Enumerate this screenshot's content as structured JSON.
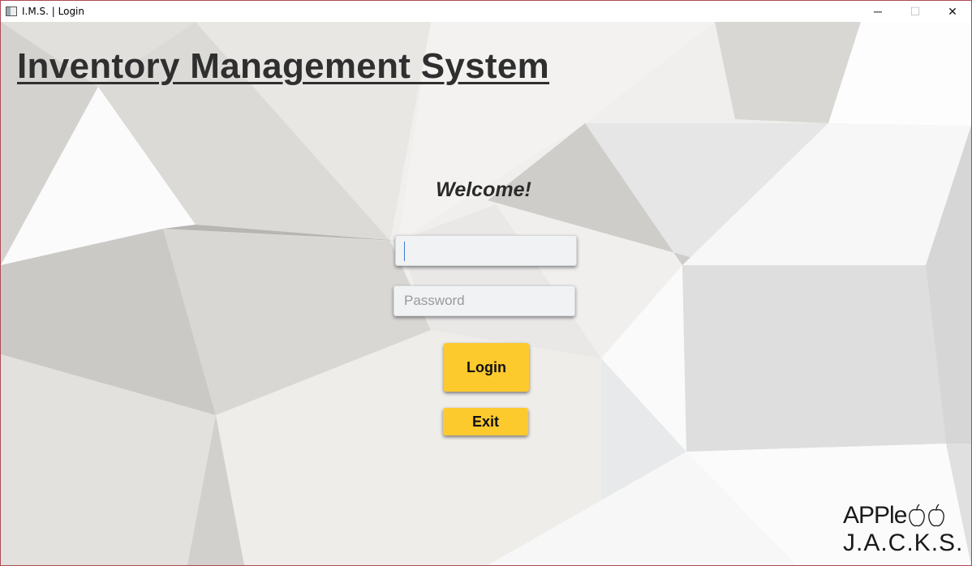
{
  "window": {
    "title": "I.M.S. | Login",
    "minimize_glyph": "─",
    "maximize_glyph": "☐",
    "close_glyph": "✕"
  },
  "header": {
    "title": "Inventory Management System"
  },
  "login_form": {
    "welcome": "Welcome!",
    "username_value": "",
    "username_placeholder": "",
    "password_placeholder": "Password",
    "login_label": "Login",
    "exit_label": "Exit"
  },
  "brand": {
    "line1": "APPle",
    "line2": "J.A.C.K.S.",
    "icon": "apples-icon"
  },
  "colors": {
    "accent_button": "#fdca2e",
    "title_text": "#2f2f2f",
    "window_border": "#b04a55",
    "field_bg": "#f1f2f4"
  }
}
